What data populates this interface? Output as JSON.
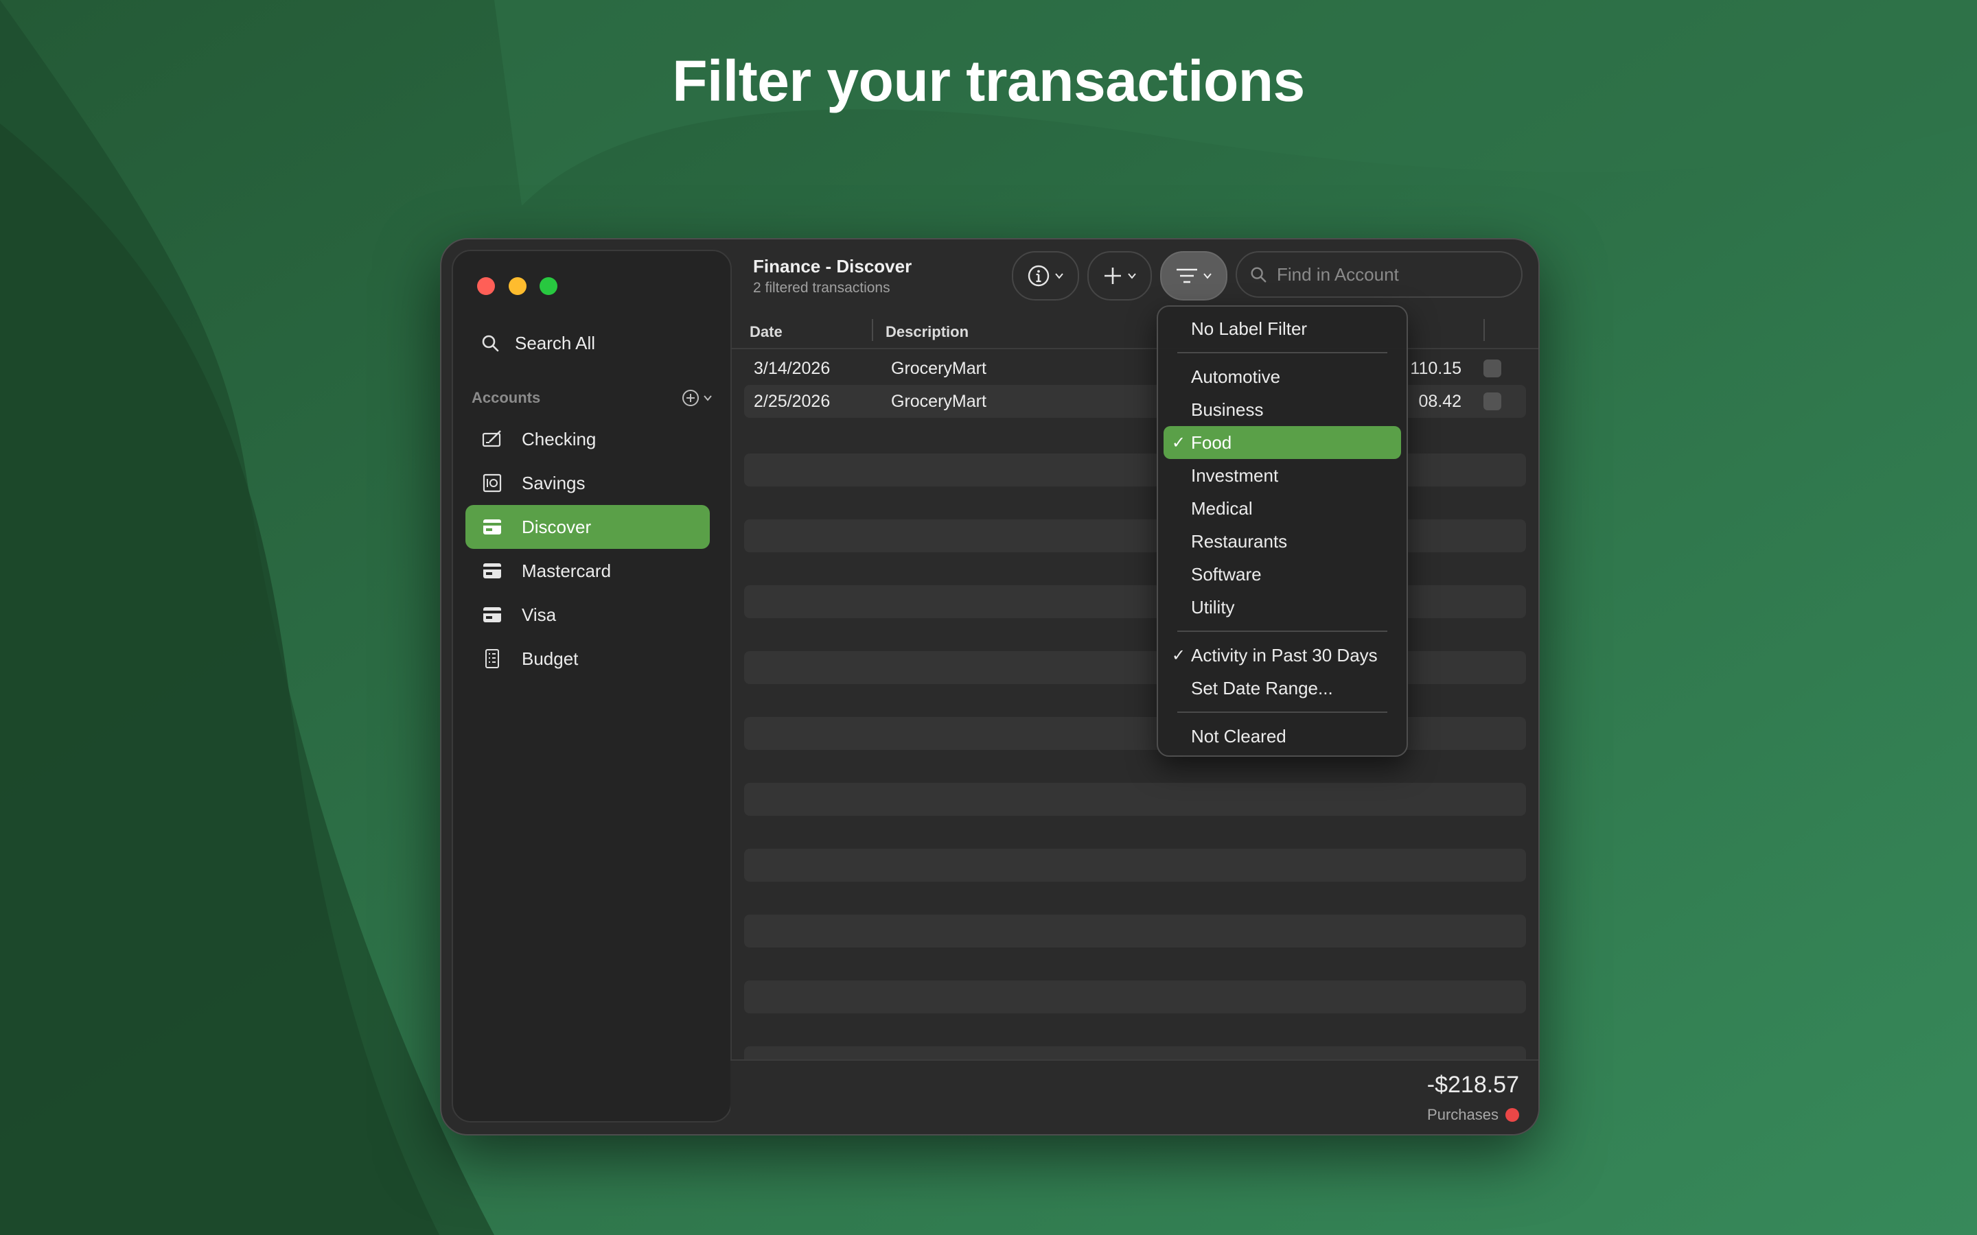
{
  "headline": "Filter your transactions",
  "window": {
    "title": "Finance - Discover",
    "subtitle": "2 filtered transactions"
  },
  "sidebar": {
    "search_all": "Search All",
    "accounts_header": "Accounts",
    "items": [
      {
        "label": "Checking",
        "icon": "checkbook-icon",
        "selected": false
      },
      {
        "label": "Savings",
        "icon": "safe-icon",
        "selected": false
      },
      {
        "label": "Discover",
        "icon": "credit-card-icon",
        "selected": true
      },
      {
        "label": "Mastercard",
        "icon": "credit-card-icon",
        "selected": false
      },
      {
        "label": "Visa",
        "icon": "credit-card-icon",
        "selected": false
      },
      {
        "label": "Budget",
        "icon": "budget-sheet-icon",
        "selected": false
      }
    ]
  },
  "toolbar": {
    "search_placeholder": "Find in Account"
  },
  "table": {
    "columns": [
      "Date",
      "Description"
    ],
    "rows": [
      {
        "date": "3/14/2026",
        "description": "GroceryMart",
        "amount": "110.15"
      },
      {
        "date": "2/25/2026",
        "description": "GroceryMart",
        "amount": "08.42"
      }
    ]
  },
  "footer": {
    "total": "-$218.57",
    "label": "Purchases"
  },
  "filter_menu": {
    "no_label": "No Label Filter",
    "labels": [
      {
        "label": "Automotive",
        "checked": false
      },
      {
        "label": "Business",
        "checked": false
      },
      {
        "label": "Food",
        "checked": true
      },
      {
        "label": "Investment",
        "checked": false
      },
      {
        "label": "Medical",
        "checked": false
      },
      {
        "label": "Restaurants",
        "checked": false
      },
      {
        "label": "Software",
        "checked": false
      },
      {
        "label": "Utility",
        "checked": false
      }
    ],
    "date_past_30": "Activity in Past 30 Days",
    "date_past_30_checked": true,
    "set_date_range": "Set Date Range...",
    "not_cleared": "Not Cleared",
    "check_mark": "✓"
  },
  "colors": {
    "accent": "#5aa048",
    "background": "#2c6a40",
    "status_dot": "#ea4747"
  }
}
